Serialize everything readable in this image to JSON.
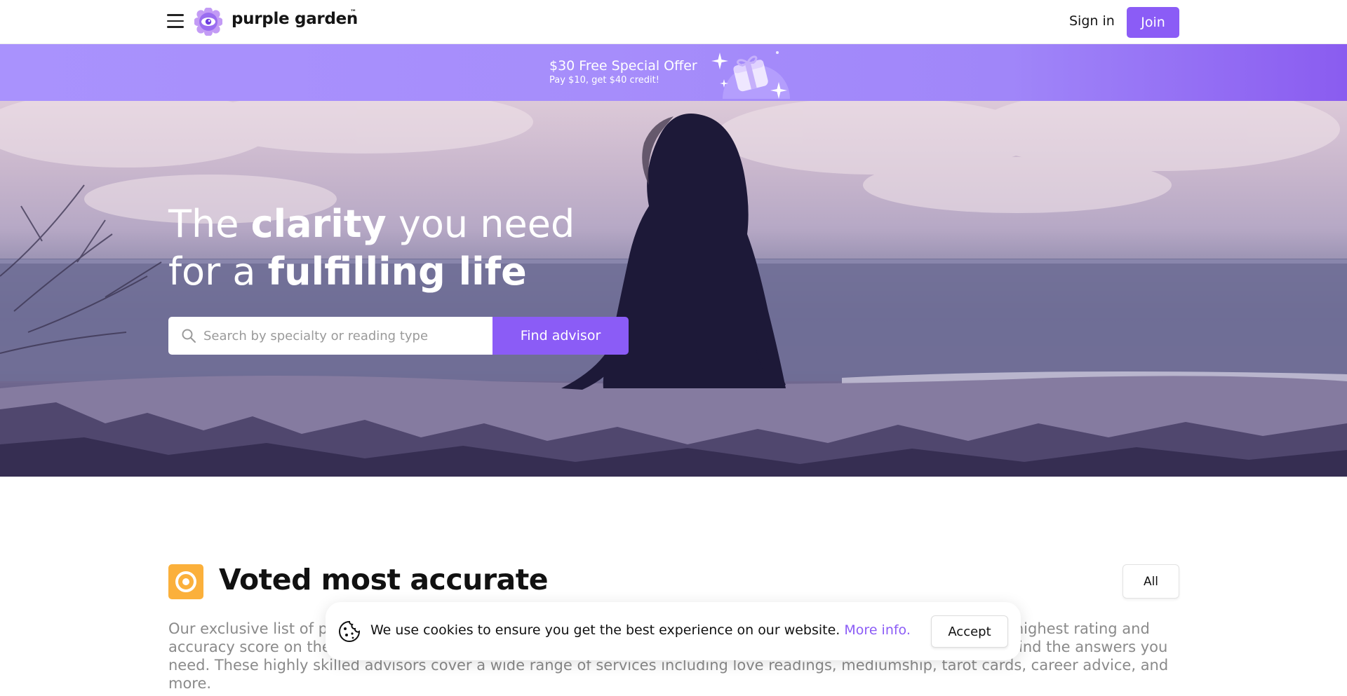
{
  "header": {
    "logo_text": "purple garden",
    "logo_tm": "™",
    "signin_label": "Sign in",
    "join_label": "Join",
    "brand_color": "#8b5cf6"
  },
  "promo": {
    "title": "$30 Free Special Offer",
    "subtitle": "Pay $10, get $40 credit!"
  },
  "hero": {
    "title_line1_a": "The ",
    "title_line1_b": "clarity",
    "title_line1_c": " you need",
    "title_line2_a": "for a ",
    "title_line2_b": "fulfilling life",
    "search_placeholder": "Search by specialty or reading type",
    "search_value": "",
    "find_label": "Find advisor"
  },
  "section": {
    "title": "Voted most accurate",
    "filter_label": "All",
    "icon_color": "#fbb03b",
    "description": "Our exclusive list of psychics who are voted most accurate by our community. Discover the best advisors with the highest rating and accuracy score on the site. These advisors who are ready to enlighten, guide and inspire you are here to help you find the answers you need. These highly skilled advisors cover a wide range of services including love readings, mediumship, tarot cards, career advice, and more."
  },
  "cookie": {
    "text": "We use cookies to ensure you get the best experience on our website.",
    "link_label": "More info.",
    "accept_label": "Accept"
  }
}
